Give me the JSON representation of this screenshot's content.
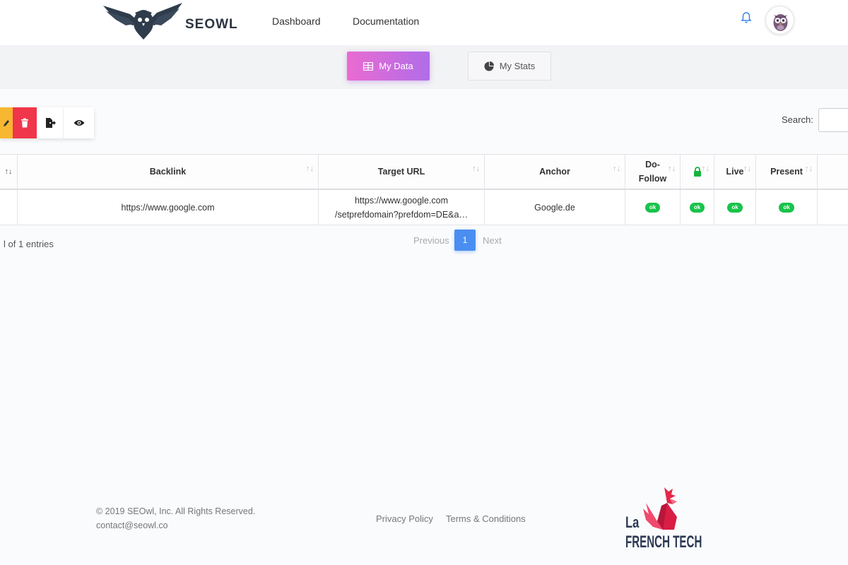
{
  "header": {
    "brand": "SEOWL",
    "nav": [
      "Dashboard",
      "Documentation"
    ],
    "icons": {
      "notifications": "bell-icon",
      "avatar": "owl-avatar"
    }
  },
  "tabs": [
    {
      "label": "My Data",
      "icon": "table-icon",
      "active": true
    },
    {
      "label": "My Stats",
      "icon": "pie-chart-icon",
      "active": false
    }
  ],
  "toolbar": {
    "buttons": [
      {
        "name": "edit",
        "icon": "pencil-icon",
        "color": "#f7b731"
      },
      {
        "name": "delete",
        "icon": "trash-icon",
        "color": "#f0364a"
      },
      {
        "name": "export",
        "icon": "export-icon",
        "color": "#ffffff"
      },
      {
        "name": "view",
        "icon": "eye-icon",
        "color": "#ffffff"
      }
    ]
  },
  "search": {
    "label": "Search:",
    "value": ""
  },
  "table": {
    "headers": [
      "Backlink",
      "Target URL",
      "Anchor",
      "Do-Follow",
      "",
      "Live",
      "Present"
    ],
    "rows": [
      {
        "backlink": "https://www.google.com",
        "target_url_line1": "https://www.google.com",
        "target_url_line2": "/setprefdomain?prefdom=DE&a…",
        "anchor": "Google.de",
        "do_follow": "ok",
        "secure": "ok",
        "live": "ok",
        "present": "ok"
      }
    ]
  },
  "pagination": {
    "entries": "l of 1 entries",
    "previous": "Previous",
    "current": "1",
    "next": "Next"
  },
  "footer": {
    "copyright": "© 2019 SEOwl, Inc. All Rights Reserved.",
    "contact": "contact@seowl.co",
    "links": [
      "Privacy Policy",
      "Terms & Conditions"
    ],
    "badge_line1": "La",
    "badge_line2": "FRENCH TECH"
  },
  "colors": {
    "accent_start": "#ea6bd1",
    "accent_end": "#b06de9",
    "ok": "#19c34b",
    "page_active": "#4a8ef2"
  }
}
